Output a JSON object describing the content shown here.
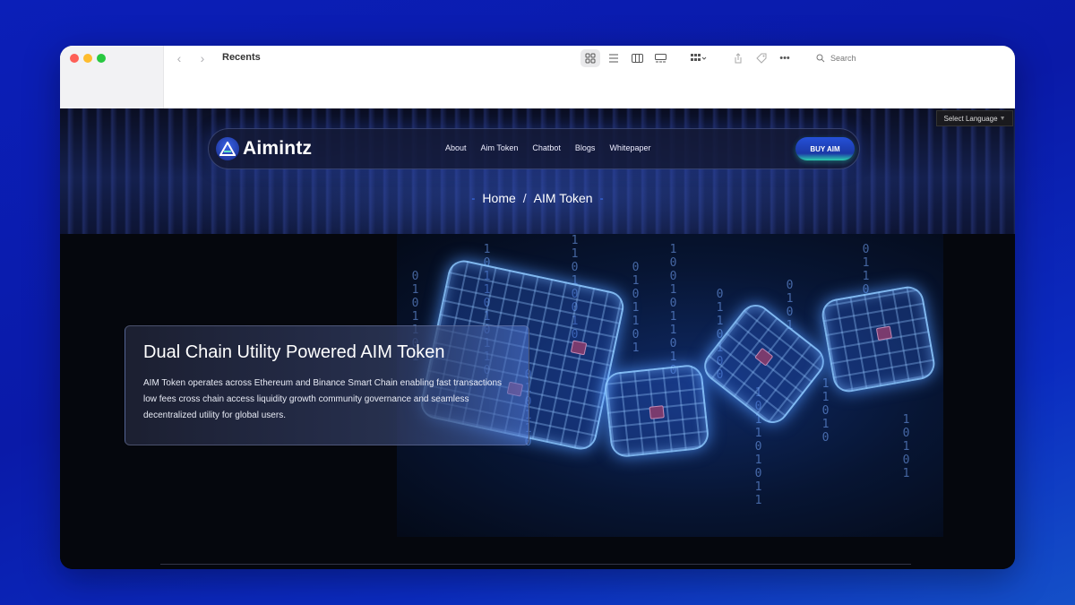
{
  "finder": {
    "title": "Recents",
    "search_placeholder": "Search"
  },
  "site": {
    "language_select": "Select Language",
    "logo_text": "Aimintz",
    "nav": [
      "About",
      "Aim Token",
      "Chatbot",
      "Blogs",
      "Whitepaper"
    ],
    "buy_button": "BUY AIM",
    "breadcrumb": {
      "home": "Home",
      "separator": "/",
      "current": "AIM Token"
    },
    "card": {
      "title": "Dual Chain Utility Powered AIM Token",
      "text": "AIM Token operates across Ethereum and Binance Smart Chain enabling fast transactions low fees cross chain access liquidity growth community governance and seamless decentralized utility for global users."
    }
  },
  "colors": {
    "background": "#0b1fb8",
    "accent": "#2550d8",
    "accent_glow": "#2bd0b0"
  }
}
